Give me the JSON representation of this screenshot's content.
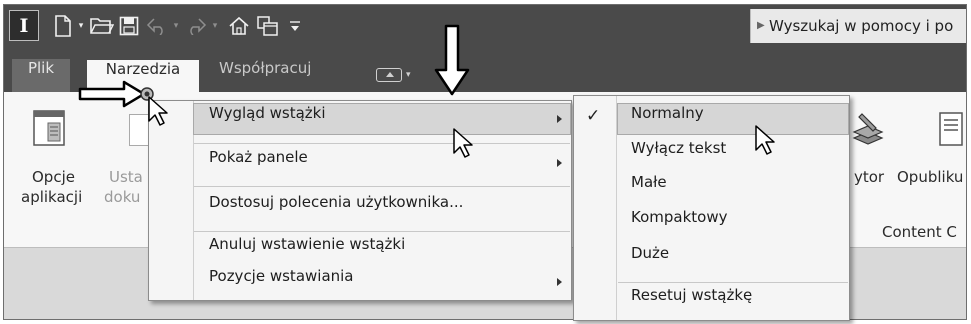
{
  "app": {
    "logo_letter": "I"
  },
  "quick_access": [
    "new-file-icon",
    "chevron-down-icon",
    "open-folder-icon",
    "save-icon",
    "undo-icon",
    "chevron-down-icon",
    "redo-icon",
    "chevron-down-icon",
    "home-icon",
    "window-switch-icon",
    "customize-icon"
  ],
  "search": {
    "text": "Wyszukaj w pomocy i po"
  },
  "tabs": {
    "file": "Plik",
    "tools": "Narzedzia",
    "collab": "Współpracuj"
  },
  "ribbon": {
    "app_options_line1": "Opcje",
    "app_options_line2": "aplikacji",
    "doc_settings_line1": "Usta",
    "doc_settings_line2": "doku",
    "editor_label": "ytor",
    "publish_label": "Opubliku",
    "content_center_label": "Content C"
  },
  "context_menu": {
    "items": [
      {
        "label": "Wygląd wstążki"
      },
      {
        "label": "Pokaż panele"
      },
      {
        "label": "Dostosuj polecenia użytkownika..."
      },
      {
        "label": "Anuluj wstawienie wstążki"
      },
      {
        "label": "Pozycje wstawiania"
      }
    ]
  },
  "submenu": {
    "check_glyph": "✓",
    "items": [
      {
        "label": "Normalny"
      },
      {
        "label": "Wyłącz tekst"
      },
      {
        "label": "Małe"
      },
      {
        "label": "Kompaktowy"
      },
      {
        "label": "Duże"
      },
      {
        "label": "Resetuj wstążkę"
      }
    ]
  },
  "colors": {
    "title_bar": "#4a4a4a",
    "ribbon": "#f7f7f7",
    "menu": "#f5f5f5",
    "highlight": "#d6d6d6"
  }
}
